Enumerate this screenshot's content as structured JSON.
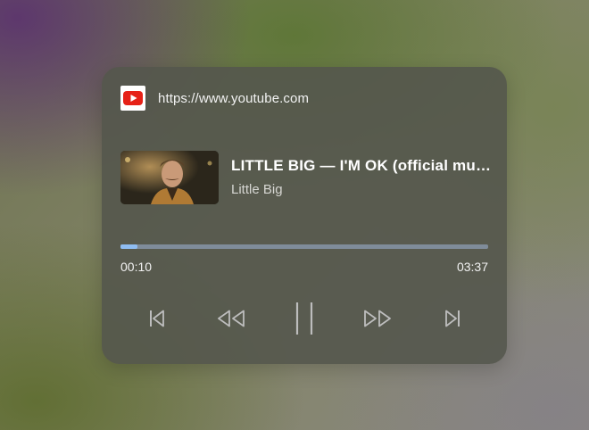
{
  "media": {
    "source_url": "https://www.youtube.com",
    "title": "LITTLE BIG — I'M OK (official music video)",
    "artist": "Little Big",
    "elapsed": "00:10",
    "duration": "03:37",
    "progress_fraction": 0.046
  },
  "icons": {
    "favicon": "youtube-logo-icon",
    "previous": "skip-previous-icon",
    "rewind": "rewind-icon",
    "pause": "pause-icon",
    "forward": "fast-forward-icon",
    "next": "skip-next-icon"
  },
  "colors": {
    "accent": "#8fbdf2",
    "youtube_red": "#e62117"
  }
}
